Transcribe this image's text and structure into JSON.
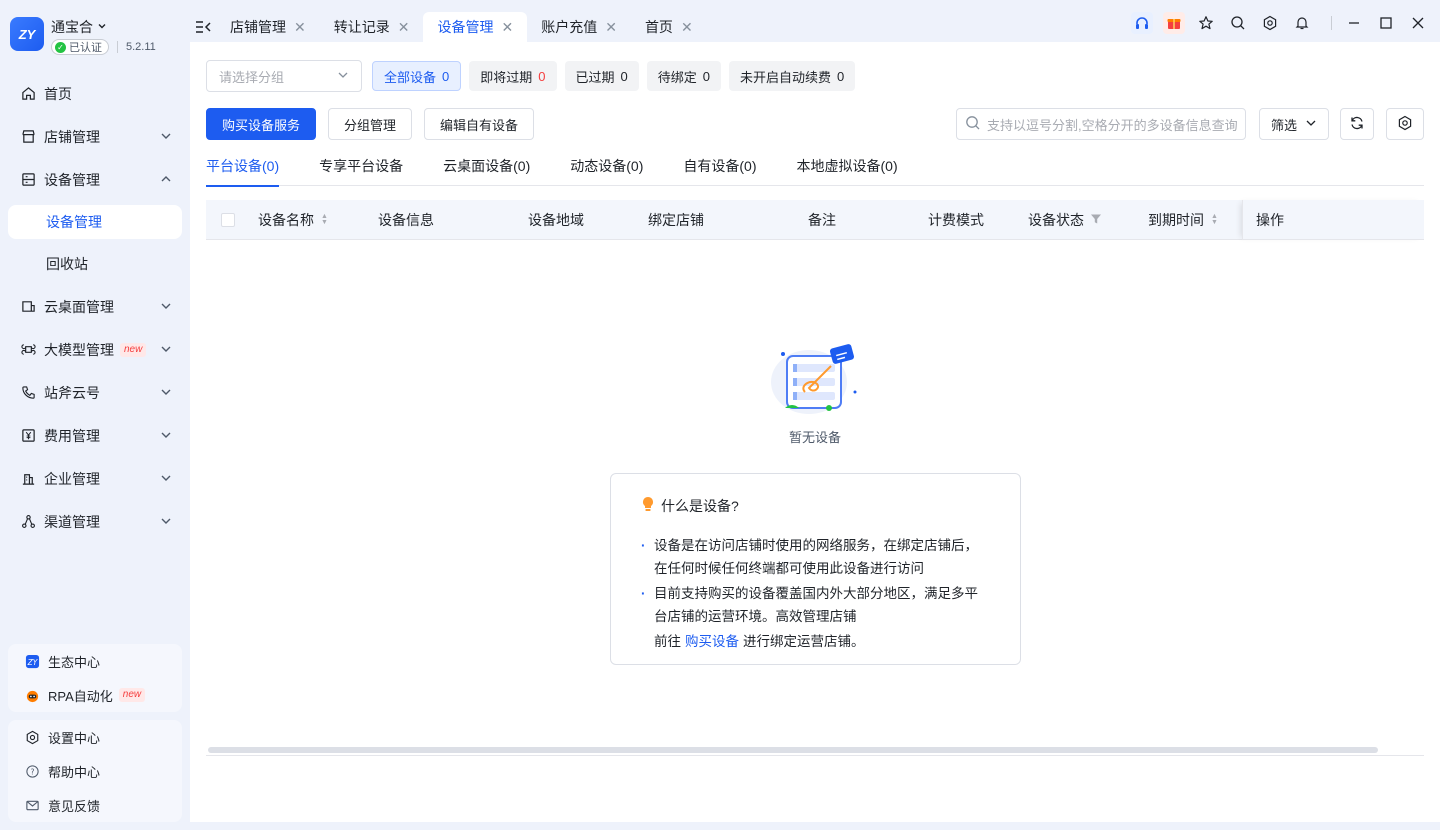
{
  "app": {
    "name": "通宝合",
    "verified": "已认证",
    "version": "5.2.11"
  },
  "sidebar": {
    "items": [
      {
        "label": "首页"
      },
      {
        "label": "店铺管理"
      },
      {
        "label": "设备管理"
      },
      {
        "label": "云桌面管理"
      },
      {
        "label": "大模型管理",
        "badge": "new"
      },
      {
        "label": "站斧云号"
      },
      {
        "label": "费用管理"
      },
      {
        "label": "企业管理"
      },
      {
        "label": "渠道管理"
      }
    ],
    "subitems": [
      {
        "label": "设备管理"
      },
      {
        "label": "回收站"
      }
    ],
    "extras": [
      {
        "label": "生态中心"
      },
      {
        "label": "RPA自动化",
        "badge": "new"
      }
    ],
    "bottom": [
      {
        "label": "设置中心"
      },
      {
        "label": "帮助中心"
      },
      {
        "label": "意见反馈"
      }
    ]
  },
  "tabs": [
    {
      "label": "店铺管理"
    },
    {
      "label": "转让记录"
    },
    {
      "label": "设备管理"
    },
    {
      "label": "账户充值"
    },
    {
      "label": "首页"
    }
  ],
  "filters": {
    "group_placeholder": "请选择分组",
    "chips": [
      {
        "label": "全部设备",
        "count": "0"
      },
      {
        "label": "即将过期",
        "count": "0"
      },
      {
        "label": "已过期",
        "count": "0"
      },
      {
        "label": "待绑定",
        "count": "0"
      },
      {
        "label": "未开启自动续费",
        "count": "0"
      }
    ]
  },
  "actions": {
    "buy": "购买设备服务",
    "group": "分组管理",
    "edit": "编辑自有设备"
  },
  "search": {
    "placeholder": "支持以逗号分割,空格分开的多设备信息查询"
  },
  "filter_btn": "筛选",
  "subtabs": [
    {
      "label": "平台设备(0)"
    },
    {
      "label": "专享平台设备"
    },
    {
      "label": "云桌面设备(0)"
    },
    {
      "label": "动态设备(0)"
    },
    {
      "label": "自有设备(0)"
    },
    {
      "label": "本地虚拟设备(0)"
    }
  ],
  "table": {
    "columns": [
      "设备名称",
      "设备信息",
      "设备地域",
      "绑定店铺",
      "备注",
      "计费模式",
      "设备状态",
      "到期时间",
      "操作"
    ],
    "empty_text": "暂无设备"
  },
  "info": {
    "title": "什么是设备?",
    "item1": "设备是在访问店铺时使用的网络服务，在绑定店铺后，在任何时候任何终端都可使用此设备进行访问",
    "item2": "目前支持购买的设备覆盖国内外大部分地区，满足多平台店铺的运营环境。高效管理店铺",
    "line3_prefix": "前往",
    "line3_link": "购买设备",
    "line3_suffix": "进行绑定运营店铺。"
  },
  "colors": {
    "primary": "#1d5cf0",
    "danger": "#f53f3f",
    "sidebar_bg": "#eef2fb"
  }
}
